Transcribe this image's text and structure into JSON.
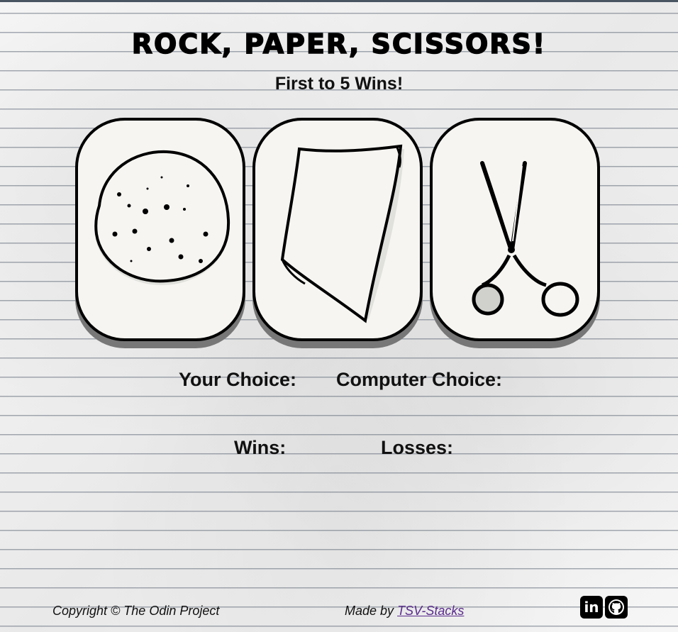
{
  "header": {
    "title": "ROCK, PAPER, SCISSORS!",
    "subtitle": "First to 5 Wins!"
  },
  "choices": [
    {
      "name": "rock",
      "icon": "rock-icon"
    },
    {
      "name": "paper",
      "icon": "paper-icon"
    },
    {
      "name": "scissors",
      "icon": "scissors-icon"
    }
  ],
  "status": {
    "your_choice_label": "Your Choice:",
    "computer_choice_label": "Computer Choice:",
    "wins_label": "Wins:",
    "losses_label": "Losses:"
  },
  "footer": {
    "copyright_text": "Copyright © The Odin Project",
    "made_by_prefix": "Made by",
    "author_link": "TSV-Stacks",
    "linkedin_icon": "in",
    "github_icon": "github-icon"
  },
  "colors": {
    "border": "#000000",
    "card_bg": "#f6f5f2",
    "card_shadow": "#777777",
    "link": "#5a2b8c"
  }
}
